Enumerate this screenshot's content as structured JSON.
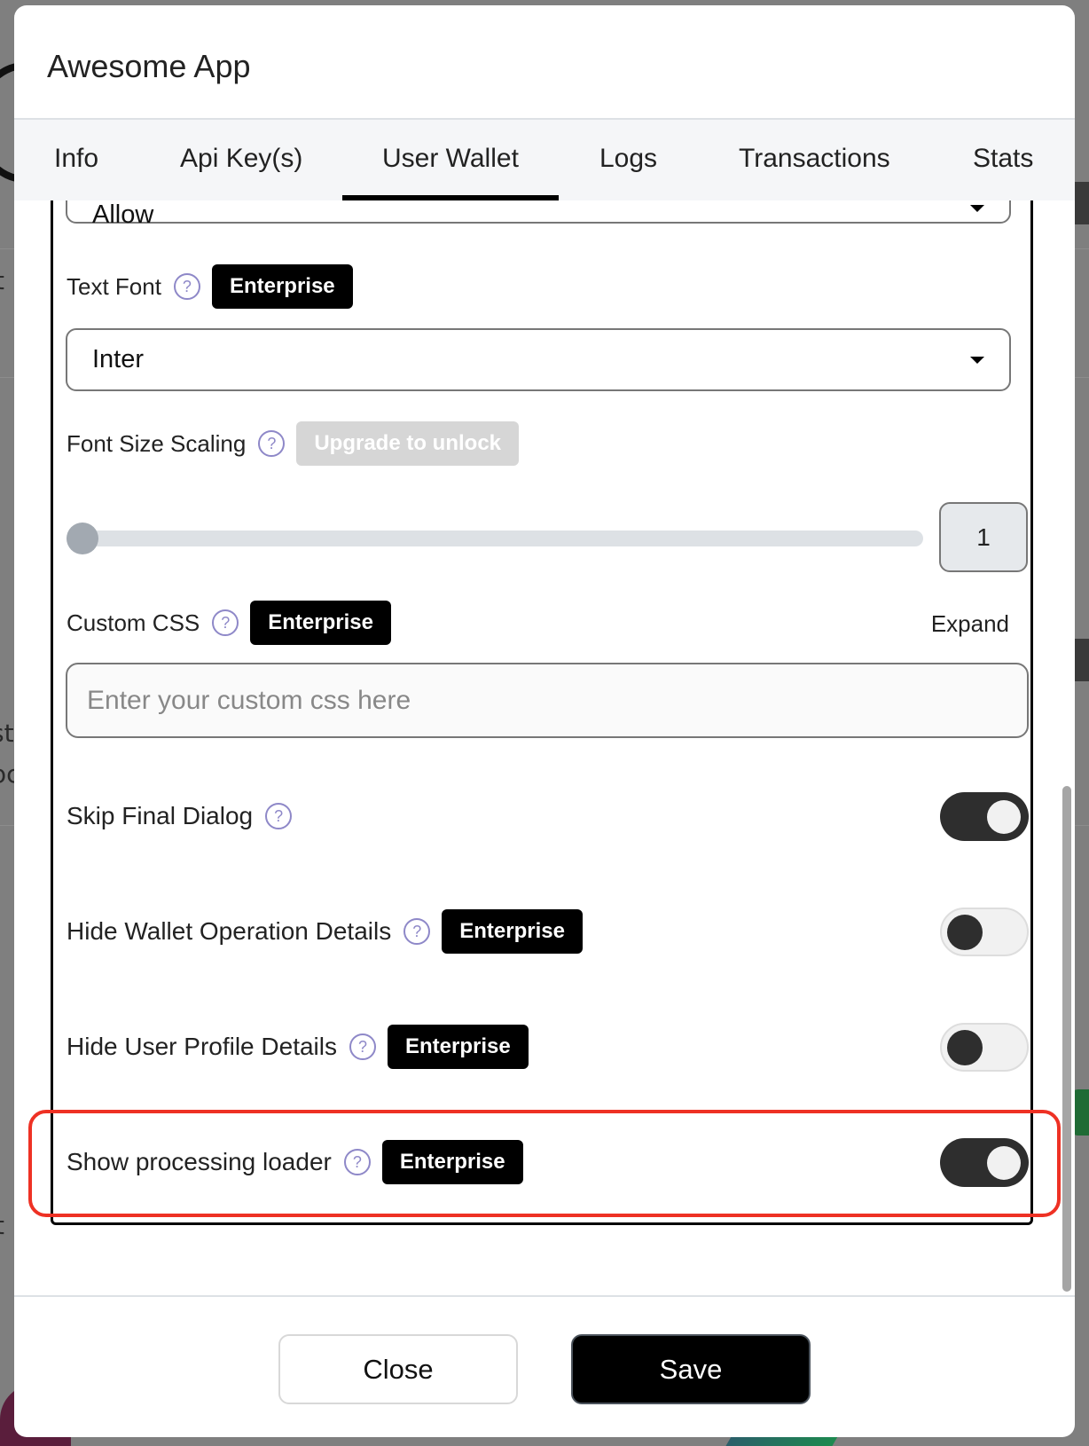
{
  "modal": {
    "title": "Awesome App"
  },
  "tabs": [
    {
      "label": "Info",
      "active": false
    },
    {
      "label": "Api Key(s)",
      "active": false
    },
    {
      "label": "User Wallet",
      "active": true
    },
    {
      "label": "Logs",
      "active": false
    },
    {
      "label": "Transactions",
      "active": false
    },
    {
      "label": "Stats",
      "active": false
    }
  ],
  "form": {
    "top_select": {
      "value": "Allow"
    },
    "text_font": {
      "label": "Text Font",
      "badge": "Enterprise",
      "value": "Inter"
    },
    "font_size_scaling": {
      "label": "Font Size Scaling",
      "badge": "Upgrade to unlock",
      "value": "1",
      "slider_fraction": 0
    },
    "custom_css": {
      "label": "Custom CSS",
      "badge": "Enterprise",
      "expand_label": "Expand",
      "placeholder": "Enter your custom css here",
      "value": ""
    },
    "toggles": [
      {
        "label": "Skip Final Dialog",
        "badge": null,
        "on": true
      },
      {
        "label": "Hide Wallet Operation Details",
        "badge": "Enterprise",
        "on": false
      },
      {
        "label": "Hide User Profile Details",
        "badge": "Enterprise",
        "on": false
      },
      {
        "label": "Show processing loader",
        "badge": "Enterprise",
        "on": true,
        "highlighted": true
      }
    ],
    "help_icon_glyph": "?"
  },
  "footer": {
    "close_label": "Close",
    "save_label": "Save"
  },
  "colors": {
    "accent": "#000000",
    "help_icon": "#8e88c8",
    "highlight": "#ee3124",
    "toggle_on": "#2e2e2e",
    "locked_badge": "#d6d6d6"
  }
}
